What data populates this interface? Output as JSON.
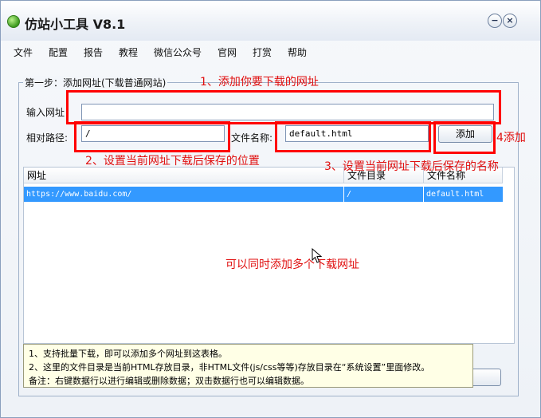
{
  "window": {
    "title": "仿站小工具 V8.1"
  },
  "menu": [
    "文件",
    "配置",
    "报告",
    "教程",
    "微信公众号",
    "官网",
    "打赏",
    "帮助"
  ],
  "group": {
    "legend": "第一步：添加网址(下载普通网站)"
  },
  "form": {
    "url_label": "输入网址",
    "url_value": "",
    "path_label": "相对路径:",
    "path_value": "/",
    "filename_label": "文件名称:",
    "filename_value": "default.html",
    "add_button": "添加"
  },
  "table": {
    "columns": [
      "网址",
      "文件目录",
      "文件名称"
    ],
    "rows": [
      [
        "https://www.baidu.com/",
        "/",
        "default.html"
      ]
    ]
  },
  "annotations": {
    "step1": "1、添加你要下载的网址",
    "step2": "2、设置当前网址下载后保存的位置",
    "step3": "3、设置当前网址下载后保存的名称",
    "step4": "4添加",
    "multi": "可以同时添加多个下载网址"
  },
  "tips": [
    "1、支持批量下载，即可以添加多个网址到这表格。",
    "2、这里的文件目录是当前HTML存放目录，非HTML文件(js/css等等)存放目录在“系统设置”里面修改。",
    "备注：右键数据行以进行编辑或删除数据；双击数据行也可以编辑数据。"
  ],
  "colors": {
    "accent_red": "#ff0000",
    "selection": "#3399ff"
  },
  "icons": {
    "app": "app-icon",
    "minimize": "minimize-icon",
    "close": "close-icon",
    "cursor": "mouse-cursor-icon"
  }
}
